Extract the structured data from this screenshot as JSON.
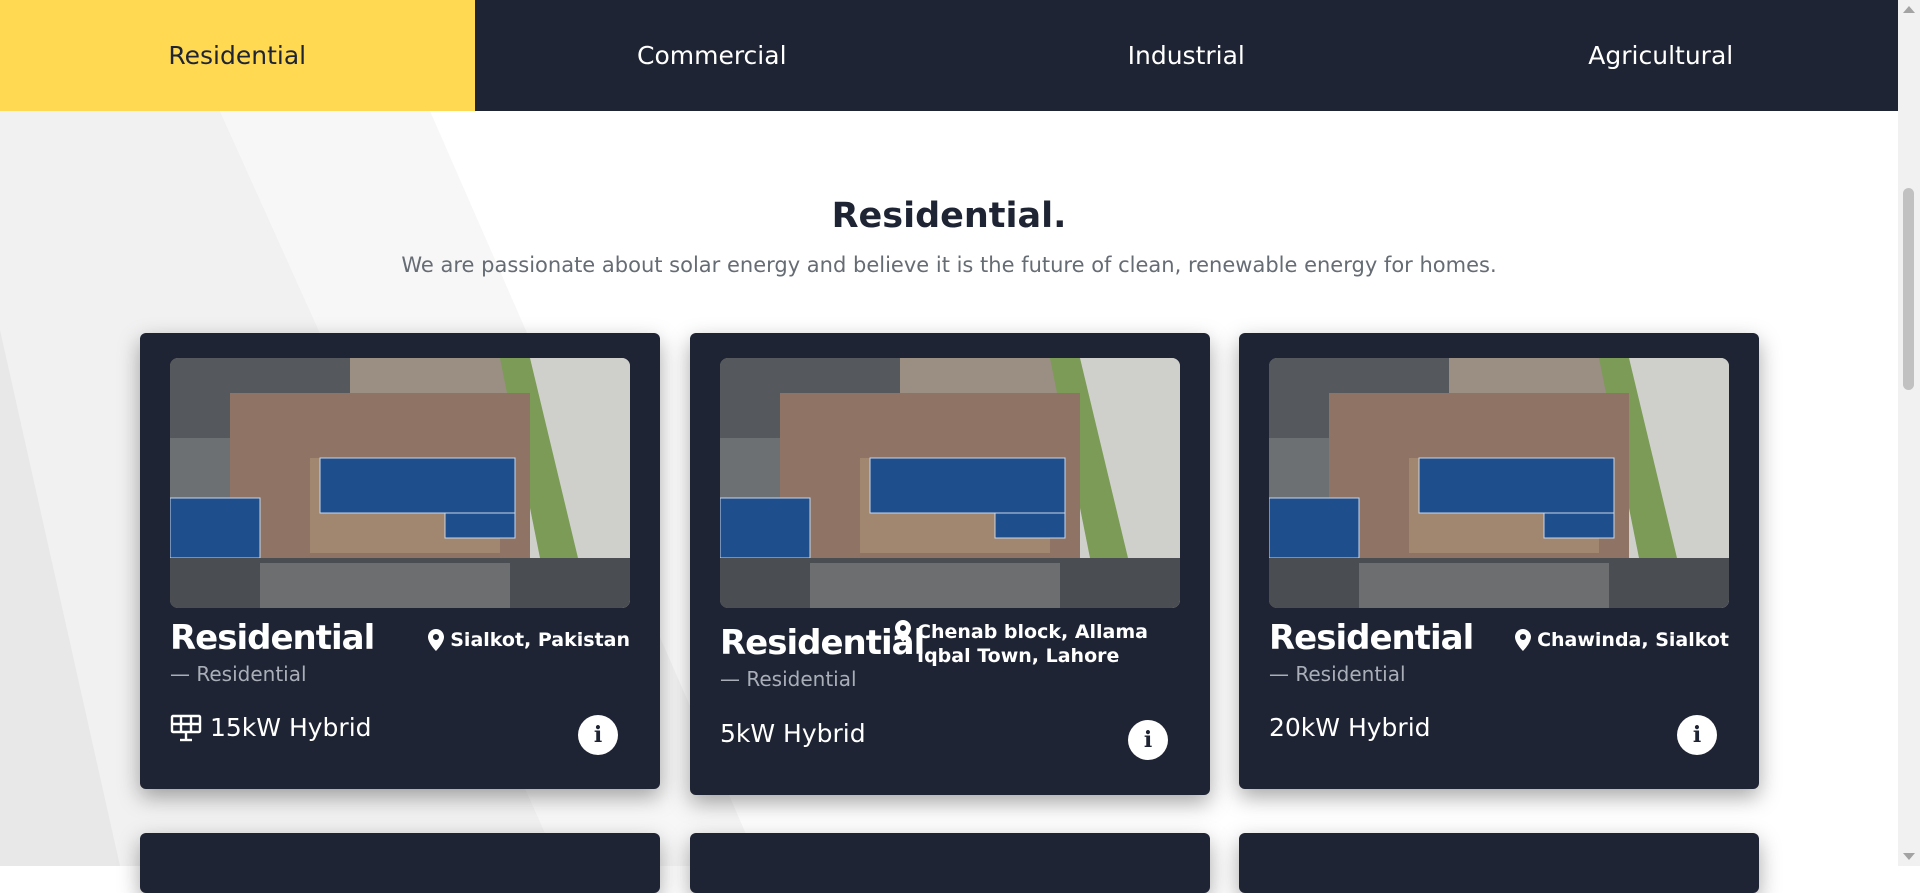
{
  "tabs": [
    {
      "label": "Residential",
      "active": true
    },
    {
      "label": "Commercial",
      "active": false
    },
    {
      "label": "Industrial",
      "active": false
    },
    {
      "label": "Agricultural",
      "active": false
    }
  ],
  "section": {
    "title": "Residential.",
    "subtitle": "We are passionate about solar energy and believe it is the future of clean, renewable energy for homes."
  },
  "cards": [
    {
      "title": "Residential",
      "category": "— Residential",
      "location": "Sialkot, Pakistan",
      "spec": "15kW Hybrid",
      "spec_icon": "solar-panel-icon"
    },
    {
      "title": "Residential",
      "category": "— Residential",
      "location": "Chenab block, Allama Iqbal Town, Lahore",
      "spec": "5kW Hybrid"
    },
    {
      "title": "Residential",
      "category": "— Residential",
      "location": "Chawinda, Sialkot",
      "spec": "20kW Hybrid"
    }
  ],
  "colors": {
    "navy": "#1e2433",
    "accent": "#ffd952",
    "muted_text": "#666c74"
  }
}
